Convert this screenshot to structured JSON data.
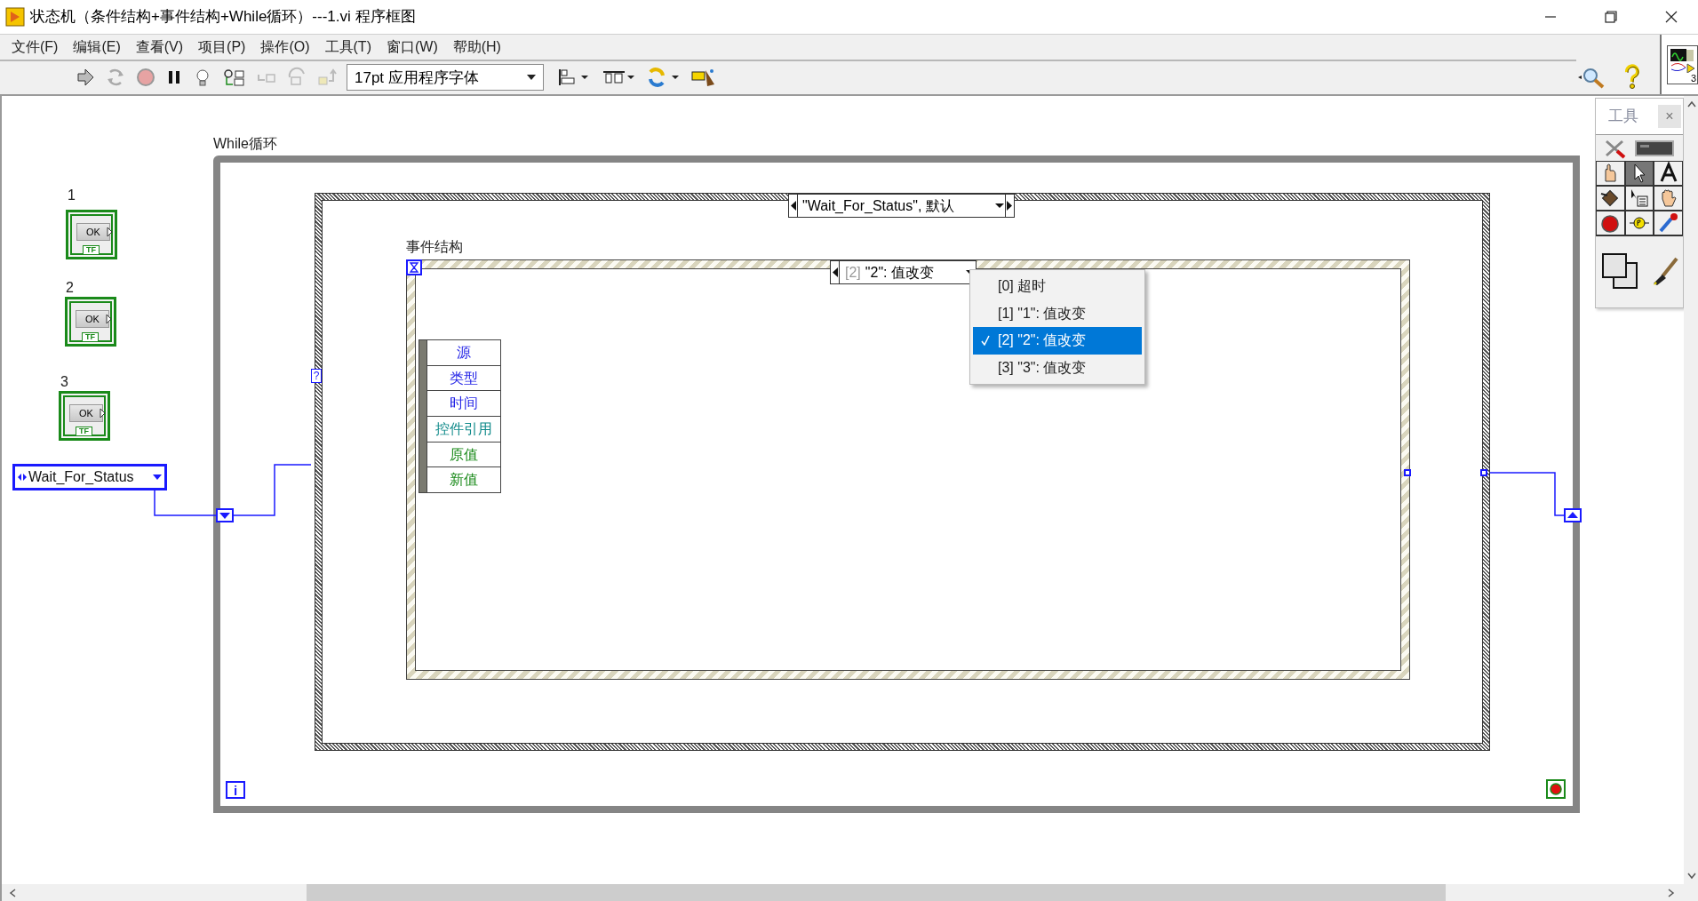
{
  "window": {
    "title": "状态机（条件结构+事件结构+While循环）---1.vi 程序框图"
  },
  "menu": [
    "文件(F)",
    "编辑(E)",
    "查看(V)",
    "项目(P)",
    "操作(O)",
    "工具(T)",
    "窗口(W)",
    "帮助(H)"
  ],
  "toolbar": {
    "font_selector": "17pt 应用程序字体",
    "vi_icon_badge": "3"
  },
  "diagram": {
    "controls": [
      {
        "label": "1",
        "button_text": "OK",
        "type_label": "TF"
      },
      {
        "label": "2",
        "button_text": "OK",
        "type_label": "TF"
      },
      {
        "label": "3",
        "button_text": "OK",
        "type_label": "TF"
      }
    ],
    "enum_constant": {
      "value": "Wait_For_Status"
    },
    "while_loop": {
      "label": "While循环",
      "iteration_terminal": "i"
    },
    "case_structure": {
      "selector": "\"Wait_For_Status\", 默认",
      "selector_terminal": "?"
    },
    "event_structure": {
      "label": "事件结构",
      "selector_index": "[2]",
      "selector": "\"2\": 值改变",
      "event_data": [
        {
          "text": "源",
          "color": "#1f1fe6"
        },
        {
          "text": "类型",
          "color": "#1f1fe6"
        },
        {
          "text": "时间",
          "color": "#1f1fe6"
        },
        {
          "text": "控件引用",
          "color": "#108a8a"
        },
        {
          "text": "原值",
          "color": "#1a8a1a"
        },
        {
          "text": "新值",
          "color": "#1a8a1a"
        }
      ],
      "menu": [
        {
          "text": "[0] 超时",
          "selected": false
        },
        {
          "text": "[1] \"1\": 值改变",
          "selected": false
        },
        {
          "text": "[2] \"2\": 值改变",
          "selected": true
        },
        {
          "text": "[3] \"3\": 值改变",
          "selected": false
        }
      ]
    }
  },
  "tools_palette": {
    "title": "工具",
    "close": "×"
  }
}
